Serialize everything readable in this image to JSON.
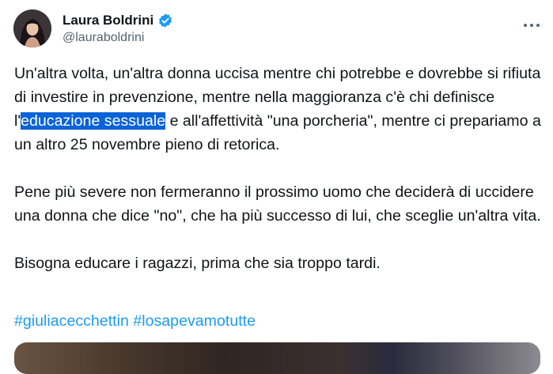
{
  "author": {
    "name": "Laura Boldrini",
    "handle": "@lauraboldrini",
    "verified": true,
    "verified_color": "#1d9bf0"
  },
  "icons": {
    "verified": "verified-badge-icon",
    "more": "more-options-icon"
  },
  "tweet": {
    "p1_before": "Un'altra volta, un'altra donna uccisa mentre chi potrebbe e dovrebbe si rifiuta di investire in prevenzione, mentre nella maggioranza c'è chi definisce l'",
    "p1_highlight": "educazione sessuale",
    "p1_after": " e all'affettività \"una porcheria\", mentre ci prepariamo a un altro 25 novembre pieno di retorica.",
    "p2": "Pene più severe non fermeranno il prossimo uomo che deciderà di uccidere una donna che dice \"no\", che ha più successo di lui, che sceglie un'altra vita.",
    "p3": "Bisogna educare i ragazzi, prima che sia troppo tardi.",
    "hashtags": [
      "#giuliacecchettin",
      "#losapevamotutte"
    ]
  },
  "colors": {
    "text": "#0f1419",
    "secondary": "#536471",
    "link": "#1d9bf0",
    "selection": "#0a63d8"
  }
}
